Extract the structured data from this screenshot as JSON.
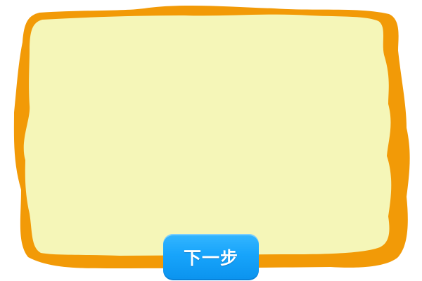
{
  "colors": {
    "frame_border": "#f29a07",
    "frame_fill": "#f5f6b8",
    "button_bg": "#17a4fb",
    "button_text": "#ffffff"
  },
  "content_panel": {
    "text": ""
  },
  "next_button": {
    "label": "下一步"
  }
}
